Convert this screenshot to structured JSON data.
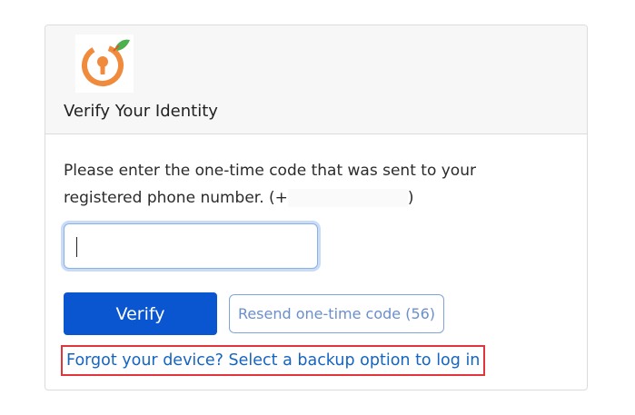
{
  "header": {
    "logo_icon": "keyhole-orange-icon",
    "title": "Verify Your Identity"
  },
  "body": {
    "instructions_text": "Please enter the one-time code that was sent to your registered phone number. (+",
    "instructions_suffix": ")"
  },
  "form": {
    "code_value": "",
    "code_placeholder": ""
  },
  "buttons": {
    "verify_label": "Verify",
    "resend_label": "Resend one-time code (56)"
  },
  "links": {
    "backup_label": "Forgot your device? Select a backup option to log in"
  },
  "colors": {
    "primary": "#0a55d0",
    "link": "#1565c0",
    "logo_orange": "#f08a3c",
    "logo_leaf": "#4caf50",
    "highlight_border": "#e0353a"
  }
}
